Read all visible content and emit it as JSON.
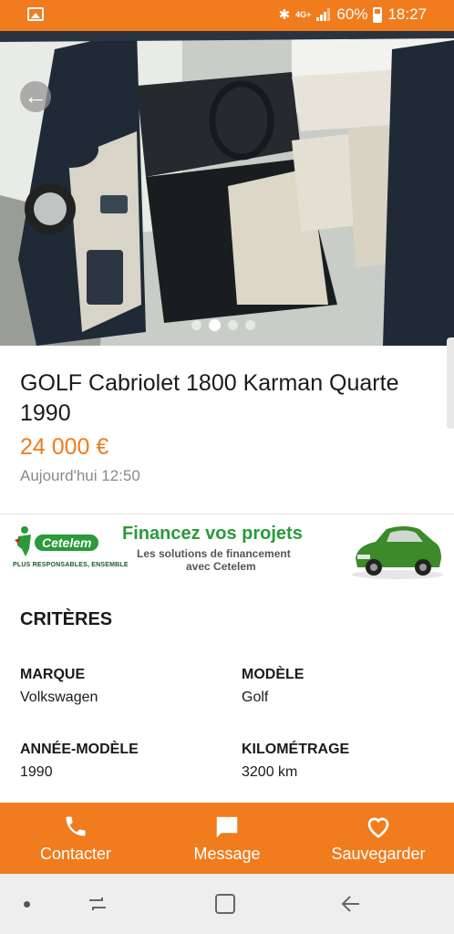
{
  "status_bar": {
    "network": "4G+",
    "battery": "60%",
    "time": "18:27"
  },
  "gallery": {
    "dots_count": 4,
    "active_index": 1
  },
  "listing": {
    "title": "GOLF Cabriolet 1800 Karman Quarte 1990",
    "price": "24 000 €",
    "date": "Aujourd'hui 12:50"
  },
  "ad": {
    "brand": "Cetelem",
    "tagline": "PLUS RESPONSABLES, ENSEMBLE",
    "headline": "Financez vos projets",
    "sub1": "Les solutions de financement",
    "sub2": "avec Cetelem"
  },
  "criteria": {
    "title": "CRITÈRES",
    "items": [
      {
        "label": "MARQUE",
        "value": "Volkswagen"
      },
      {
        "label": "MODÈLE",
        "value": "Golf"
      },
      {
        "label": "ANNÉE-MODÈLE",
        "value": "1990"
      },
      {
        "label": "KILOMÉTRAGE",
        "value": "3200 km"
      }
    ]
  },
  "actions": {
    "call": "Contacter",
    "message": "Message",
    "save": "Sauvegarder"
  },
  "colors": {
    "accent": "#f07c1e",
    "ad_green": "#2a9a3a"
  }
}
